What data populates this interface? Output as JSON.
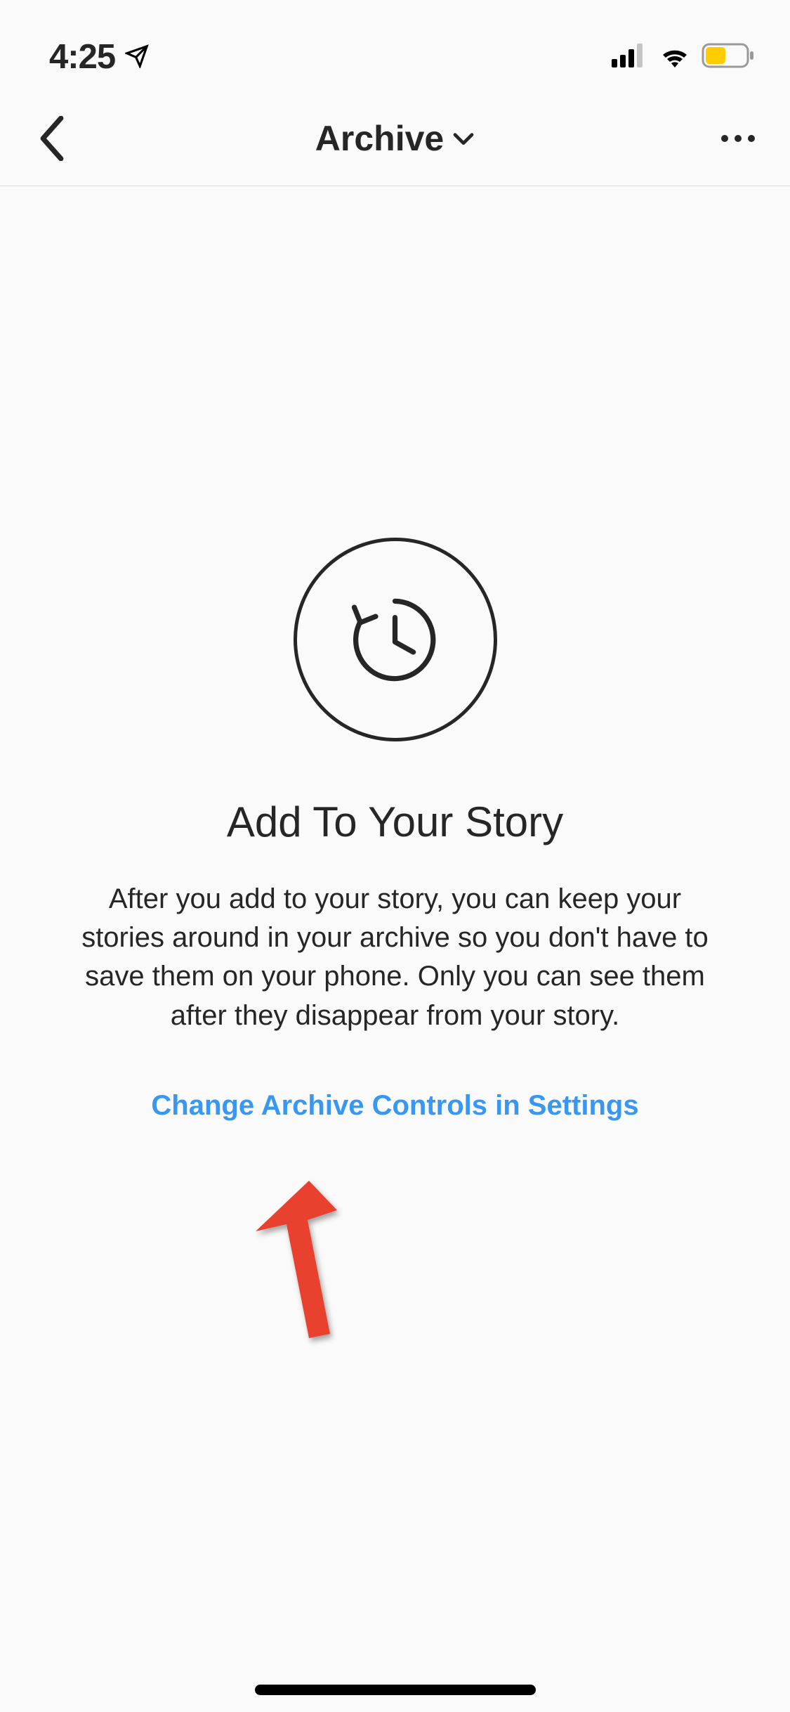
{
  "statusBar": {
    "time": "4:25"
  },
  "header": {
    "title": "Archive"
  },
  "emptyState": {
    "title": "Add To Your Story",
    "description": "After you add to your story, you can keep your stories around in your archive so you don't have to save them on your phone. Only you can see them after they disappear from your story.",
    "link": "Change Archive Controls in Settings"
  }
}
